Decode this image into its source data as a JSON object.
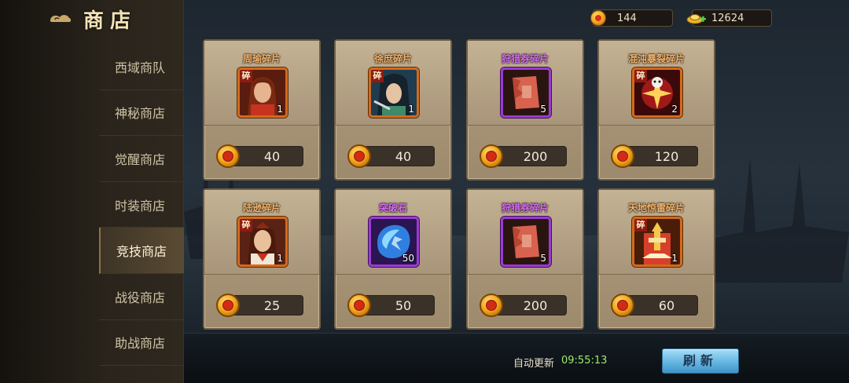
{
  "title": "商店",
  "nav": [
    {
      "label": "西域商队",
      "active": false
    },
    {
      "label": "神秘商店",
      "active": false
    },
    {
      "label": "觉醒商店",
      "active": false
    },
    {
      "label": "时装商店",
      "active": false
    },
    {
      "label": "竞技商店",
      "active": true
    },
    {
      "label": "战役商店",
      "active": false
    },
    {
      "label": "助战商店",
      "active": false
    }
  ],
  "currency": {
    "coins": "144",
    "ingots": "12624"
  },
  "items": [
    {
      "name": "周瑜碎片",
      "name_color": "#f3b36a",
      "count": "1",
      "price": "40",
      "frame": "orange",
      "fragment": true,
      "fragment_label": "碎",
      "icon": "zhouyu-portrait-icon"
    },
    {
      "name": "徐庶碎片",
      "name_color": "#f3b36a",
      "count": "1",
      "price": "40",
      "frame": "orange",
      "fragment": true,
      "fragment_label": "碎",
      "icon": "xushu-portrait-icon"
    },
    {
      "name": "狩猎券碎片",
      "name_color": "#d36cf5",
      "count": "5",
      "price": "200",
      "frame": "purple",
      "fragment": false,
      "fragment_label": "",
      "icon": "hunting-ticket-icon"
    },
    {
      "name": "混沌暴裂碎片",
      "name_color": "#f3b36a",
      "count": "2",
      "price": "120",
      "frame": "orange",
      "fragment": true,
      "fragment_label": "碎",
      "icon": "chaos-burst-icon"
    },
    {
      "name": "陆逊碎片",
      "name_color": "#f3b36a",
      "count": "1",
      "price": "25",
      "frame": "orange",
      "fragment": true,
      "fragment_label": "碎",
      "icon": "luxun-portrait-icon"
    },
    {
      "name": "突破石",
      "name_color": "#d36cf5",
      "count": "50",
      "price": "50",
      "frame": "purple",
      "fragment": false,
      "fragment_label": "",
      "icon": "breakthrough-stone-icon"
    },
    {
      "name": "狩猎券碎片",
      "name_color": "#d36cf5",
      "count": "5",
      "price": "200",
      "frame": "purple",
      "fragment": false,
      "fragment_label": "",
      "icon": "hunting-ticket-icon"
    },
    {
      "name": "天地惊雷碎片",
      "name_color": "#f3b36a",
      "count": "1",
      "price": "60",
      "frame": "orange",
      "fragment": true,
      "fragment_label": "碎",
      "icon": "thunder-skill-icon"
    }
  ],
  "footer": {
    "auto_refresh_label": "自动更新",
    "auto_refresh_time": "09:55:13",
    "refresh_button": "刷新"
  }
}
